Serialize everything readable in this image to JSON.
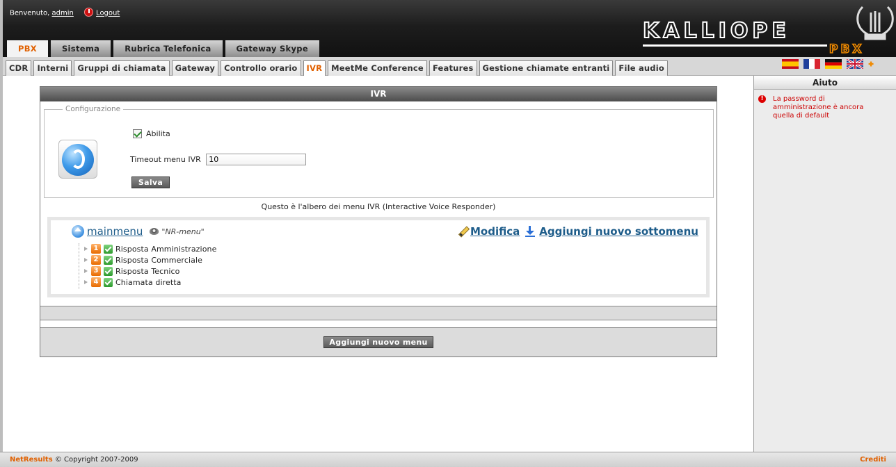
{
  "header": {
    "welcome_text": "Benvenuto,",
    "username": "admin",
    "logout_label": "Logout",
    "logo_text": "KALLIOPE",
    "logo_sub": "PBX"
  },
  "main_tabs": [
    {
      "label": "PBX",
      "active": true
    },
    {
      "label": "Sistema"
    },
    {
      "label": "Rubrica Telefonica"
    },
    {
      "label": "Gateway Skype"
    }
  ],
  "sub_tabs": [
    {
      "label": "CDR"
    },
    {
      "label": "Interni"
    },
    {
      "label": "Gruppi di chiamata"
    },
    {
      "label": "Gateway"
    },
    {
      "label": "Controllo orario"
    },
    {
      "label": "IVR",
      "active": true
    },
    {
      "label": "MeetMe Conference"
    },
    {
      "label": "Features"
    },
    {
      "label": "Gestione chiamate entranti"
    },
    {
      "label": "File audio"
    }
  ],
  "flags": [
    "spanish-flag-icon",
    "french-flag-icon",
    "german-flag-icon",
    "uk-flag-icon",
    "add-language-icon"
  ],
  "panel": {
    "title": "IVR",
    "config_legend": "Configurazione",
    "enable_label": "Abilita",
    "enable_checked": true,
    "timeout_label": "Timeout menu IVR",
    "timeout_value": "10",
    "save_label": "Salva",
    "tree_caption": "Questo è l'albero dei menu IVR (Interactive Voice Responder)",
    "add_menu_label": "Aggiungi nuovo menu"
  },
  "tree": {
    "root_label": "mainmenu",
    "root_audio": "\"NR-menu\"",
    "edit_label": "Modifica",
    "add_submenu_label": "Aggiungi nuovo sottomenu",
    "items": [
      {
        "num": "1",
        "label": "Risposta Amministrazione"
      },
      {
        "num": "2",
        "label": "Risposta Commerciale"
      },
      {
        "num": "3",
        "label": "Risposta Tecnico"
      },
      {
        "num": "4",
        "label": "Chiamata diretta"
      }
    ]
  },
  "sidebar": {
    "title": "Aiuto",
    "message": "La password di amministrazione è ancora quella di default"
  },
  "footer": {
    "brand": "NetResults",
    "copyright": "© Copyright 2007-2009",
    "credits": "Crediti"
  },
  "colors": {
    "accent": "#e06000",
    "link": "#1d5c8a",
    "warning": "#cc0000"
  }
}
